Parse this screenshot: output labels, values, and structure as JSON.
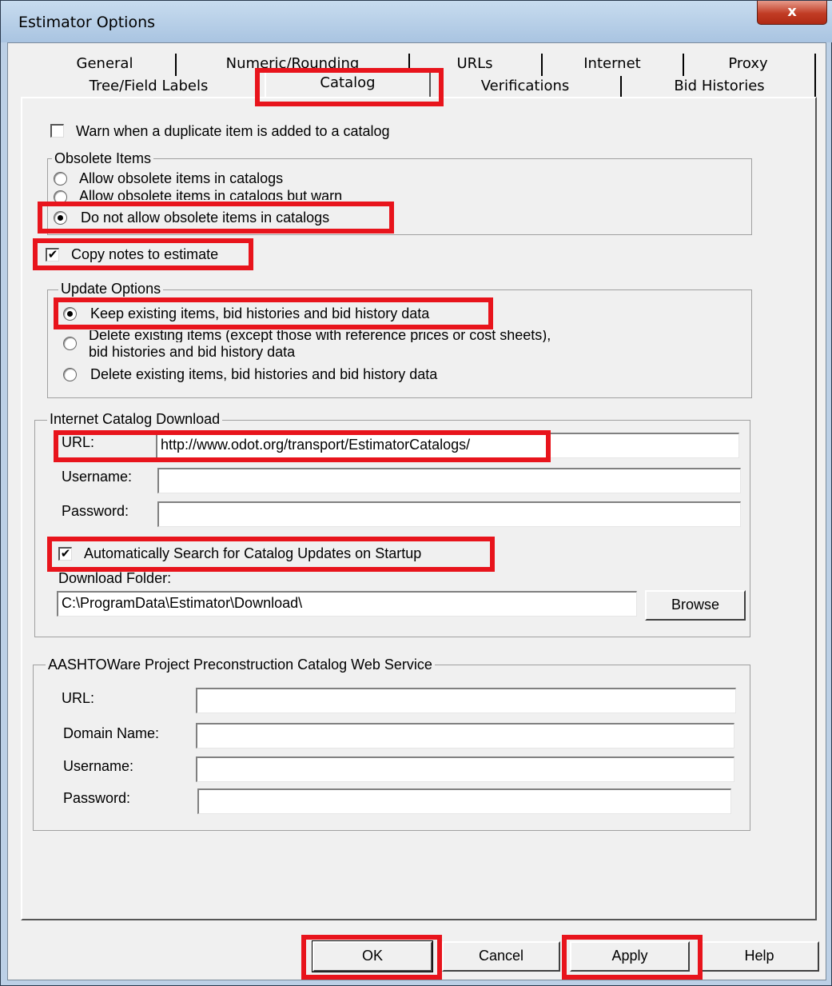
{
  "window": {
    "title": "Estimator Options",
    "close_glyph": "x"
  },
  "tabs": {
    "row1": [
      "General",
      "Numeric/Rounding",
      "URLs",
      "Internet",
      "Proxy"
    ],
    "row2": [
      "Tree/Field Labels",
      "Catalog",
      "Verifications",
      "Bid Histories"
    ],
    "active": "Catalog"
  },
  "catalog": {
    "warn_duplicate": {
      "label": "Warn when a duplicate item is added to a catalog",
      "checked": false
    },
    "obsolete": {
      "legend": "Obsolete Items",
      "options": [
        "Allow obsolete items in catalogs",
        "Allow obsolete items in catalogs but warn",
        "Do not allow obsolete items in catalogs"
      ],
      "selected": 2
    },
    "copy_notes": {
      "label": "Copy notes to estimate",
      "checked": true
    },
    "update": {
      "legend": "Update Options",
      "options": [
        "Keep existing items, bid histories and bid history data",
        "Delete existing items (except those with reference prices or cost sheets),",
        "bid histories and bid history data",
        "Delete existing items, bid histories and bid history data"
      ],
      "selected": 0
    },
    "internet": {
      "legend": "Internet Catalog Download",
      "url_label": "URL:",
      "url_value": "http://www.odot.org/transport/EstimatorCatalogs/",
      "username_label": "Username:",
      "username_value": "",
      "password_label": "Password:",
      "password_value": "",
      "auto_search": {
        "label": "Automatically Search for Catalog Updates on Startup",
        "checked": true
      },
      "folder_label": "Download Folder:",
      "folder_value": "C:\\ProgramData\\Estimator\\Download\\",
      "browse_label": "Browse"
    },
    "aashto": {
      "legend": "AASHTOWare Project Preconstruction Catalog Web Service",
      "url_label": "URL:",
      "url_value": "",
      "domain_label": "Domain Name:",
      "domain_value": "",
      "username_label": "Username:",
      "username_value": "",
      "password_label": "Password:",
      "password_value": ""
    }
  },
  "buttons": {
    "ok": "OK",
    "cancel": "Cancel",
    "apply": "Apply",
    "help": "Help"
  },
  "colors": {
    "highlight": "#e8141c",
    "title_bar": "#bcd0e6",
    "close_button": "#c13c24"
  },
  "check_glyph": "✔"
}
